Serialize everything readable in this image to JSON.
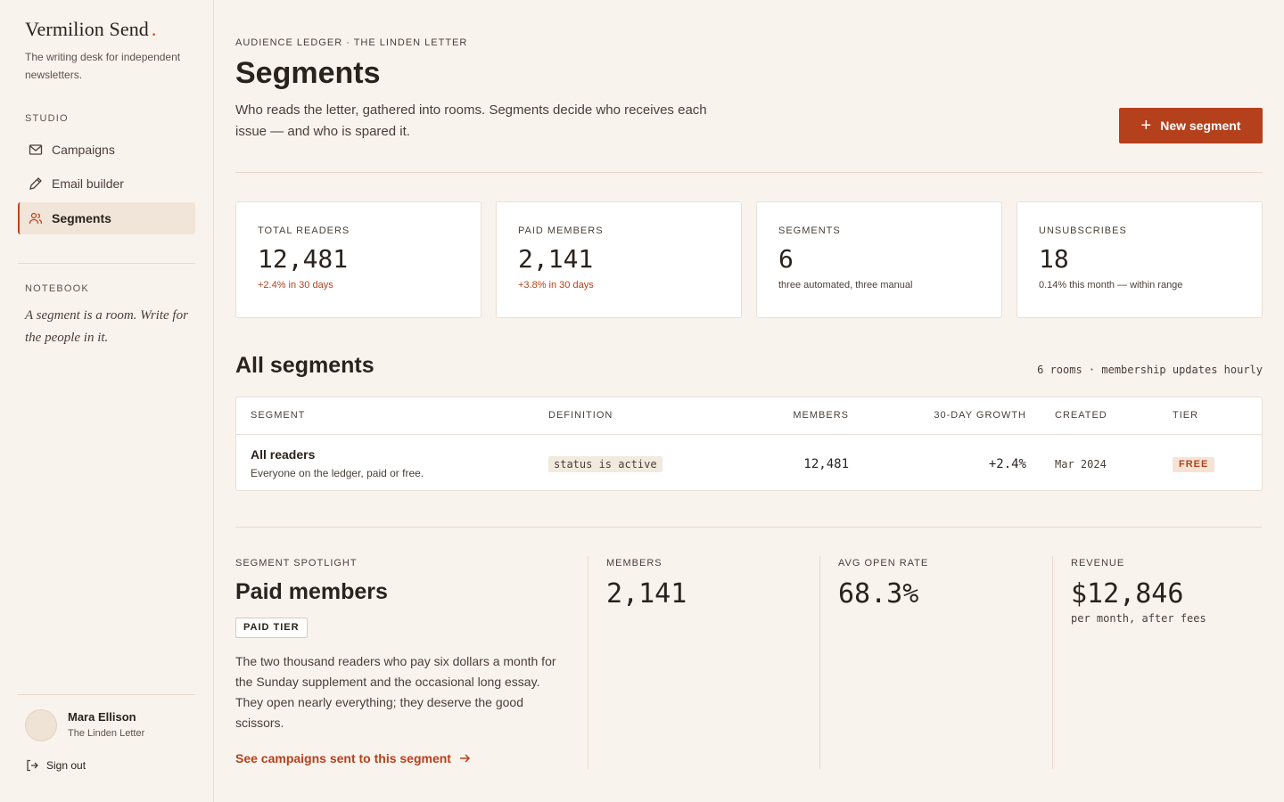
{
  "sidebar": {
    "brand": "Vermilion Send",
    "brand_dot": ".",
    "tagline": "The writing desk for independent newsletters.",
    "studio_label": "STUDIO",
    "items": [
      {
        "label": "Campaigns",
        "icon": "mail-icon"
      },
      {
        "label": "Email builder",
        "icon": "pen-icon"
      },
      {
        "label": "Segments",
        "icon": "users-icon",
        "active": true
      }
    ],
    "notebook_label": "NOTEBOOK",
    "note": "A segment is a room. Write for the people in it.",
    "user": {
      "name": "Mara Ellison",
      "publication": "The Linden Letter"
    },
    "signout": "Sign out"
  },
  "header": {
    "breadcrumb": "AUDIENCE LEDGER · THE LINDEN LETTER",
    "title": "Segments",
    "description": "Who reads the letter, gathered into rooms. Segments decide who receives each issue — and who is spared it.",
    "new_button": "New segment",
    "new_button_icon": "+"
  },
  "stats": [
    {
      "label": "TOTAL READERS",
      "value": "12,481",
      "note": "+2.4% in 30 days",
      "positive": true
    },
    {
      "label": "PAID MEMBERS",
      "value": "2,141",
      "note": "+3.8% in 30 days",
      "positive": true
    },
    {
      "label": "SEGMENTS",
      "value": "6",
      "note": "three automated, three manual",
      "positive": false
    },
    {
      "label": "UNSUBSCRIBES",
      "value": "18",
      "note": "0.14% this month — within range",
      "positive": false
    }
  ],
  "segments": {
    "title": "All segments",
    "meta": "6 rooms · membership updates hourly",
    "columns": [
      "SEGMENT",
      "DEFINITION",
      "MEMBERS",
      "30-DAY GROWTH",
      "CREATED",
      "TIER"
    ],
    "rows": [
      {
        "name": "All readers",
        "description": "Everyone on the ledger, paid or free.",
        "definition": "status is active",
        "members": "12,481",
        "growth": "+2.4%",
        "created": "Mar 2024",
        "tier": "FREE"
      }
    ]
  },
  "spotlight": {
    "label": "SEGMENT SPOTLIGHT",
    "title": "Paid members",
    "badge": "PAID TIER",
    "description": "The two thousand readers who pay six dollars a month for the Sunday supplement and the occasional long essay. They open nearly everything; they deserve the good scissors.",
    "link": "See campaigns sent to this segment",
    "members_label": "MEMBERS",
    "members": "2,141",
    "open_rate_label": "AVG OPEN RATE",
    "open_rate": "68.3%",
    "revenue_label": "REVENUE",
    "revenue": "$12,846",
    "revenue_note": "per month, after fees"
  },
  "colors": {
    "accent": "#b5401c",
    "background": "#f9f3ed",
    "card": "#ffffff"
  }
}
